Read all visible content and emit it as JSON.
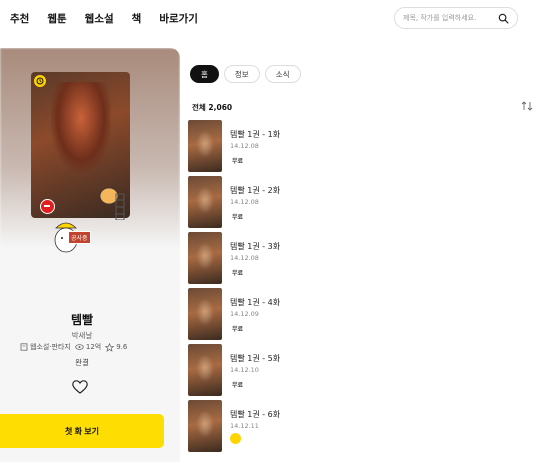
{
  "nav": {
    "items": [
      "추천",
      "웹툰",
      "웹소설",
      "책",
      "바로가기"
    ]
  },
  "search": {
    "placeholder": "제목, 작가를 입력하세요."
  },
  "cover": {
    "stamp": "공사중"
  },
  "work": {
    "title": "템빨",
    "author": "박새날",
    "genre": "웹소설·판타지",
    "views": "12억",
    "rating": "9.6",
    "status": "완결"
  },
  "cta": {
    "label": "첫 화 보기"
  },
  "tabs": [
    {
      "label": "홈",
      "active": true
    },
    {
      "label": "정보",
      "active": false
    },
    {
      "label": "소식",
      "active": false
    }
  ],
  "list": {
    "count_label": "전체 2,060"
  },
  "episodes": [
    {
      "title": "템빨 1권 - 1화",
      "date": "14.12.08",
      "badge": "무료"
    },
    {
      "title": "템빨 1권 - 2화",
      "date": "14.12.08",
      "badge": "무료"
    },
    {
      "title": "템빨 1권 - 3화",
      "date": "14.12.08",
      "badge": "무료"
    },
    {
      "title": "템빨 1권 - 4화",
      "date": "14.12.09",
      "badge": "무료"
    },
    {
      "title": "템빨 1권 - 5화",
      "date": "14.12.10",
      "badge": "무료"
    },
    {
      "title": "템빨 1권 - 6화",
      "date": "14.12.11",
      "badge": ""
    }
  ],
  "colors": {
    "accent": "#fedd03",
    "tab_active": "#111111"
  },
  "icons": {
    "search": "search-icon",
    "heart": "heart-icon",
    "sort": "sort-icon",
    "clock": "clock-icon"
  }
}
